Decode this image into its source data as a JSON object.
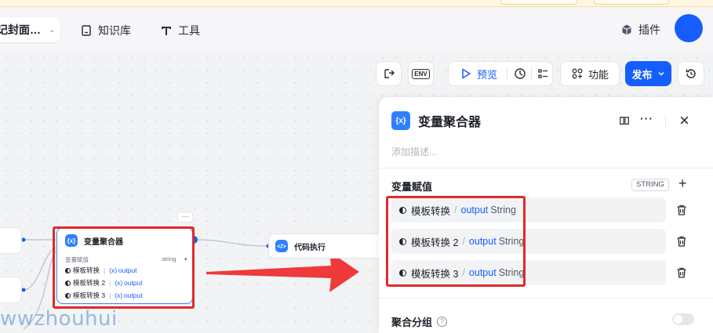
{
  "header": {
    "app_title": "记封面…",
    "nav": [
      {
        "label": "知识库",
        "icon": "book-icon"
      },
      {
        "label": "工具",
        "icon": "tool-icon"
      }
    ],
    "plugin_label": "插件"
  },
  "toolbar": {
    "env_label": "ENV",
    "preview_label": "预览",
    "feature_label": "功能",
    "publish_label": "发布"
  },
  "canvas": {
    "node_main": {
      "title": "变量聚合器",
      "section_label": "变量赋值",
      "type_label": "string",
      "more": "···",
      "rows": [
        {
          "source": "模板转换",
          "var": "output"
        },
        {
          "source": "模板转换 2",
          "var": "output"
        },
        {
          "source": "模板转换 3",
          "var": "output"
        }
      ]
    },
    "node_code": {
      "title": "代码执行"
    },
    "watermark": "wwzhouhui"
  },
  "panel": {
    "title": "变量聚合器",
    "description_placeholder": "添加描述...",
    "section_title": "变量赋值",
    "type_badge": "STRING",
    "rows": [
      {
        "source": "模板转换",
        "var": "output",
        "type": "String"
      },
      {
        "source": "模板转换 2",
        "var": "output",
        "type": "String"
      },
      {
        "source": "模板转换 3",
        "var": "output",
        "type": "String"
      }
    ],
    "group_title": "聚合分组"
  },
  "colors": {
    "accent": "#165dff",
    "highlight": "#e02a2a"
  }
}
